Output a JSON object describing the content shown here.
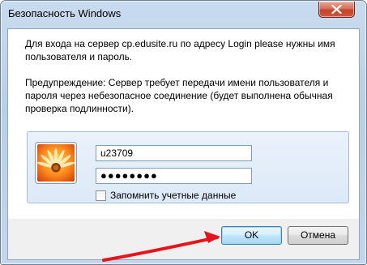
{
  "window": {
    "title": "Безопасность Windows"
  },
  "message": {
    "line1": "Для входа на сервер cp.edusite.ru по адресу Login please нужны имя пользователя и пароль.",
    "warning": "Предупреждение: Сервер требует передачи имени пользователя и пароля через небезопасное соединение (будет выполнена обычная проверка подлинности)."
  },
  "credentials": {
    "username": "u23709",
    "password_mask": "●●●●●●●●",
    "remember_label": "Запомнить учетные данные",
    "remember_checked": false
  },
  "buttons": {
    "ok": "OK",
    "cancel": "Отмена"
  },
  "icons": {
    "avatar": "flower-avatar-icon",
    "close": "close-icon"
  },
  "annotation": {
    "arrow_color": "#e8141b"
  }
}
